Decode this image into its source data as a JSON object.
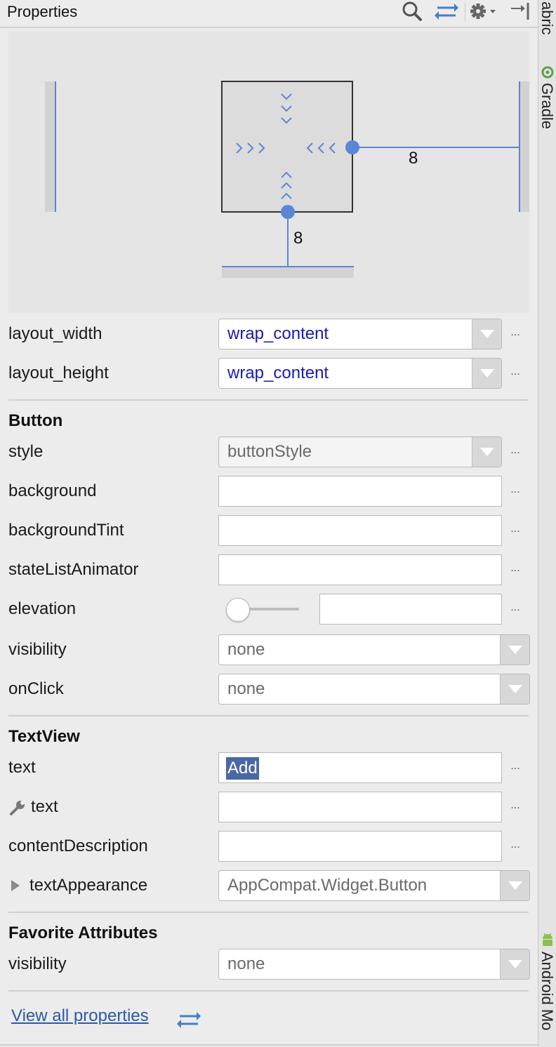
{
  "header": {
    "title": "Properties",
    "icons": [
      "search-icon",
      "swap-icon",
      "gear-icon",
      "pin-right-icon"
    ]
  },
  "constraint_preview": {
    "right_margin": "8",
    "bottom_margin": "8"
  },
  "layout": {
    "width_label": "layout_width",
    "width_value": "wrap_content",
    "height_label": "layout_height",
    "height_value": "wrap_content"
  },
  "button_section": {
    "title": "Button",
    "style_label": "style",
    "style_value": "buttonStyle",
    "background_label": "background",
    "background_tint_label": "backgroundTint",
    "state_list_animator_label": "stateListAnimator",
    "elevation_label": "elevation",
    "elevation_level": 0,
    "visibility_label": "visibility",
    "visibility_value": "none",
    "onclick_label": "onClick",
    "onclick_value": "none"
  },
  "textview_section": {
    "title": "TextView",
    "text_label": "text",
    "text_value": "Add",
    "tools_text_label": "text",
    "content_description_label": "contentDescription",
    "text_appearance_label": "textAppearance",
    "text_appearance_value": "AppCompat.Widget.Button"
  },
  "favorites_section": {
    "title": "Favorite Attributes",
    "visibility_label": "visibility",
    "visibility_value": "none"
  },
  "footer": {
    "view_all_label": "View all properties"
  },
  "right_toolbar": {
    "items": [
      "abric",
      "Gradle",
      "Android Mo"
    ]
  },
  "colors": {
    "accent": "#5b86d6",
    "link": "#2a5aa8",
    "value_blue": "#1a1ab0",
    "selection": "#4a68a4",
    "android_green": "#8cc04b"
  },
  "dots_label": "..."
}
